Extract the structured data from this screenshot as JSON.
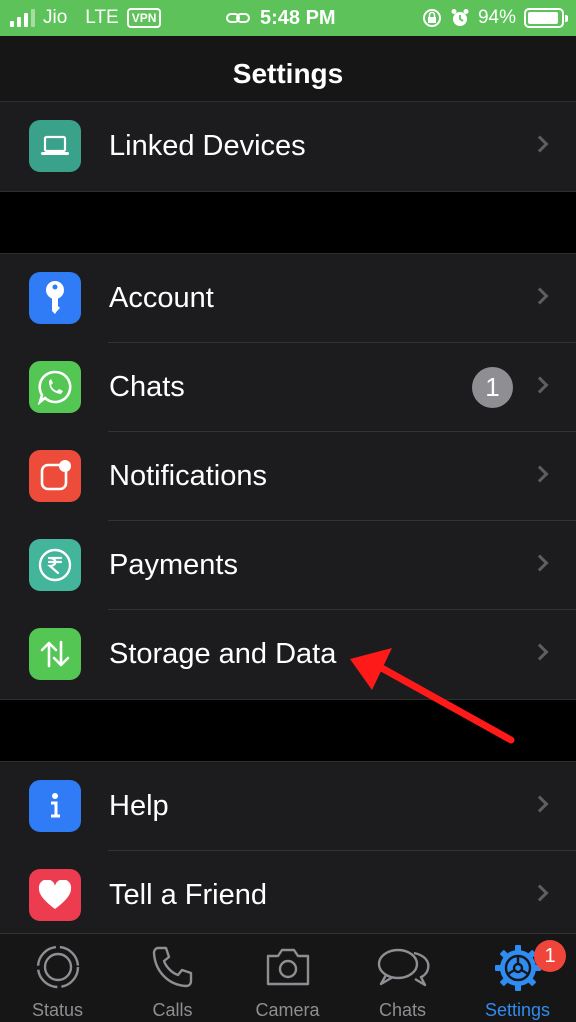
{
  "status_bar": {
    "carrier": "Jio",
    "network": "LTE",
    "vpn": "VPN",
    "time": "5:48 PM",
    "battery_percent": "94%",
    "battery_level": 0.94,
    "bar_color": "#5ec25a"
  },
  "header": {
    "title": "Settings"
  },
  "groups": [
    {
      "items": [
        {
          "label": "Linked Devices",
          "icon": "laptop-icon",
          "icon_color": "#3aa18a"
        }
      ]
    },
    {
      "items": [
        {
          "label": "Account",
          "icon": "key-icon",
          "icon_color": "#2f7cf6"
        },
        {
          "label": "Chats",
          "icon": "whatsapp-icon",
          "icon_color": "#53c654",
          "badge": "1"
        },
        {
          "label": "Notifications",
          "icon": "notification-icon",
          "icon_color": "#ee4c3b"
        },
        {
          "label": "Payments",
          "icon": "rupee-icon",
          "icon_color": "#43b59a"
        },
        {
          "label": "Storage and Data",
          "icon": "up-down-arrows-icon",
          "icon_color": "#53c654"
        }
      ]
    },
    {
      "items": [
        {
          "label": "Help",
          "icon": "info-icon",
          "icon_color": "#2f7cf6"
        },
        {
          "label": "Tell a Friend",
          "icon": "heart-icon",
          "icon_color": "#ed3b4f"
        }
      ]
    }
  ],
  "tab_bar": {
    "tabs": [
      {
        "label": "Status",
        "icon": "status-icon"
      },
      {
        "label": "Calls",
        "icon": "phone-icon"
      },
      {
        "label": "Camera",
        "icon": "camera-icon"
      },
      {
        "label": "Chats",
        "icon": "chat-bubbles-icon"
      },
      {
        "label": "Settings",
        "icon": "settings-gear-icon",
        "active": true
      }
    ],
    "settings_badge": "1",
    "active_color": "#2f8cf0"
  },
  "annotation": {
    "arrow_color": "#ff1a1a"
  }
}
